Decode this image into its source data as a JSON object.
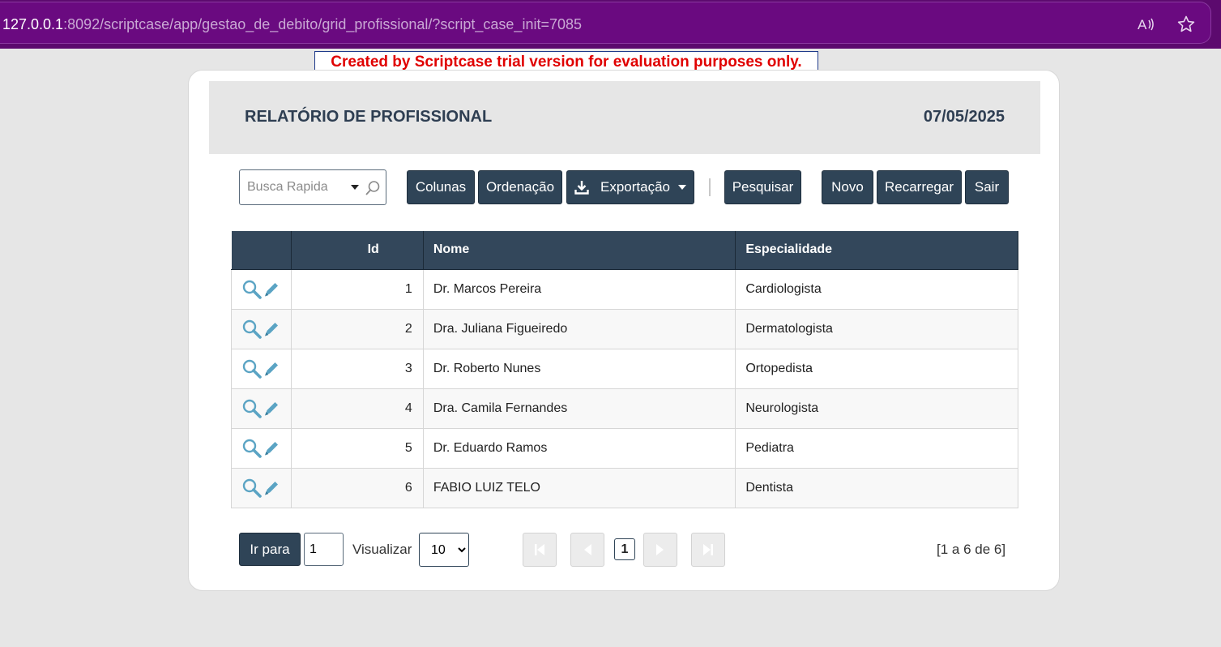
{
  "browser": {
    "url_host": "127.0.0.1",
    "url_path": ":8092/scriptcase/app/gestao_de_debito/grid_profissional/?script_case_init=7085",
    "read_aloud_icon": "read-aloud-icon",
    "favorite_icon": "star-icon"
  },
  "trial_banner": "Created by Scriptcase trial version for evaluation purposes only.",
  "header": {
    "title": "RELATÓRIO DE PROFISSIONAL",
    "date": "07/05/2025"
  },
  "toolbar": {
    "search_placeholder": "Busca Rapida",
    "columns_label": "Colunas",
    "sort_label": "Ordenação",
    "export_label": "Exportação",
    "search_label": "Pesquisar",
    "new_label": "Novo",
    "reload_label": "Recarregar",
    "exit_label": "Sair"
  },
  "table": {
    "columns": [
      "",
      "Id",
      "Nome",
      "Especialidade"
    ],
    "rows": [
      {
        "id": "1",
        "nome": "Dr. Marcos Pereira",
        "especialidade": "Cardiologista"
      },
      {
        "id": "2",
        "nome": "Dra. Juliana Figueiredo",
        "especialidade": "Dermatologista"
      },
      {
        "id": "3",
        "nome": "Dr. Roberto Nunes",
        "especialidade": "Ortopedista"
      },
      {
        "id": "4",
        "nome": "Dra. Camila Fernandes",
        "especialidade": "Neurologista"
      },
      {
        "id": "5",
        "nome": "Dr. Eduardo Ramos",
        "especialidade": "Pediatra"
      },
      {
        "id": "6",
        "nome": "FABIO LUIZ TELO",
        "especialidade": "Dentista"
      }
    ]
  },
  "footer": {
    "goto_label": "Ir para",
    "goto_value": "1",
    "view_label": "Visualizar",
    "page_size": "10",
    "current_page": "1",
    "records_info": "[1 a 6 de 6]"
  },
  "colors": {
    "browser_bar": "#5c0a6e",
    "button": "#2f4457",
    "header_row": "#33475b",
    "banner_text": "#e00000",
    "action_icon": "#5ba4c4"
  }
}
